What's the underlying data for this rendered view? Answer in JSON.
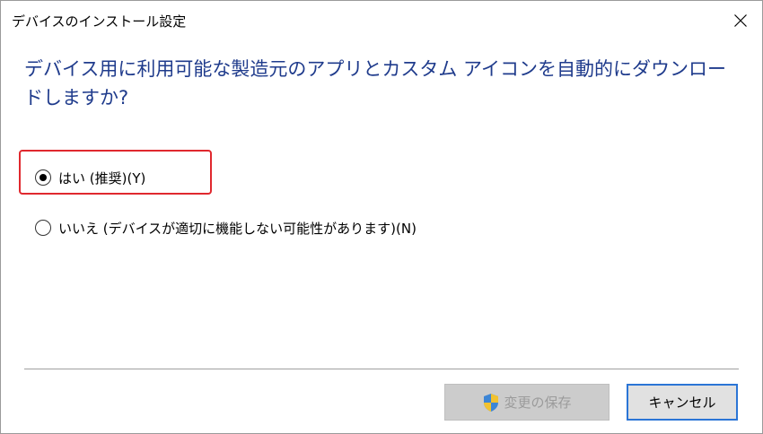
{
  "window": {
    "title": "デバイスのインストール設定"
  },
  "heading": "デバイス用に利用可能な製造元のアプリとカスタム アイコンを自動的にダウンロードしますか?",
  "options": [
    {
      "label": "はい (推奨)(Y)",
      "selected": true
    },
    {
      "label": "いいえ (デバイスが適切に機能しない可能性があります)(N)",
      "selected": false
    }
  ],
  "buttons": {
    "save_label": "変更の保存",
    "save_enabled": false,
    "cancel_label": "キャンセル"
  },
  "colors": {
    "heading": "#1f3b8c",
    "highlight": "#e0282e",
    "focus_border": "#2b75d6"
  },
  "icons": {
    "close": "close-icon",
    "shield": "uac-shield-icon"
  }
}
